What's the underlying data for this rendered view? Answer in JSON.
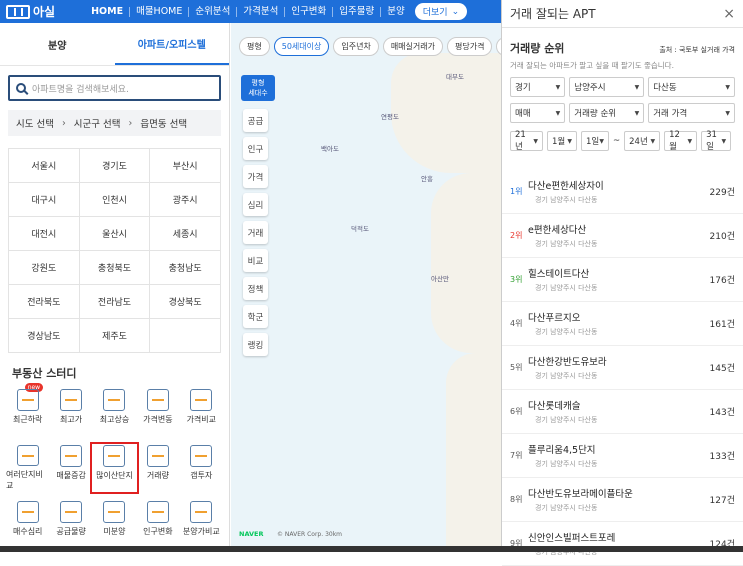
{
  "topbar": {
    "logo": "아실",
    "nav": [
      "HOME",
      "매물HOME",
      "순위분석",
      "가격분석",
      "인구변화",
      "입주물량",
      "분양"
    ],
    "more": "더보기"
  },
  "tabs": [
    "분양",
    "아파트/오피스텔"
  ],
  "search": {
    "placeholder": "아파트명을 검색해보세요."
  },
  "region": [
    "시도 선택",
    "시군구 선택",
    "읍면동 선택"
  ],
  "regions": [
    "서울시",
    "경기도",
    "부산시",
    "대구시",
    "인천시",
    "광주시",
    "대전시",
    "울산시",
    "세종시",
    "강원도",
    "충청북도",
    "충청남도",
    "전라북도",
    "전라남도",
    "경상북도",
    "경상남도",
    "제주도"
  ],
  "study": {
    "title": "부동산 스터디",
    "items": [
      "최근하락",
      "최고가",
      "최고상승",
      "가격변동",
      "가격비교",
      "여러단지비교",
      "매물증감",
      "많이산단지",
      "거래량",
      "갭투자",
      "매수심리",
      "공급물량",
      "미분양",
      "인구변화",
      "분양가비교"
    ],
    "new_badge": "new"
  },
  "map": {
    "chips": [
      "평형",
      "50세대이상",
      "입주년차",
      "매매실거래가",
      "평당가격",
      "매"
    ],
    "badge": [
      "평형",
      "세대수"
    ],
    "side": [
      "공급",
      "인구",
      "가격",
      "심리",
      "거래",
      "비교",
      "정책",
      "학군",
      "랭킹"
    ],
    "labels": [
      "백아도",
      "연평도",
      "덕적도",
      "아산만",
      "안흥",
      "대부도"
    ],
    "naver": "NAVER",
    "copyright": "© NAVER Corp.",
    "scale": "30km"
  },
  "panel": {
    "title": "거래 잘되는 APT",
    "close": "×",
    "subtitle": "거래량 순위",
    "source": "출처 : 국토부 실거래 가격",
    "desc": "거래 잘되는 아파트가 팔고 싶을 때 팔기도 좋습니다.",
    "selects1": [
      "경기",
      "남양주시",
      "다산동"
    ],
    "selects2": [
      "매매",
      "거래량 순위",
      "거래 가격"
    ],
    "dates": [
      "21년",
      "1월",
      "1일",
      "~",
      "24년",
      "12월",
      "31일"
    ],
    "ranks": [
      {
        "rank": "1위",
        "name": "다산e편한세상자이",
        "addr": "경기 남양주시 다산동",
        "count": "229건",
        "color": "#1e6fd9"
      },
      {
        "rank": "2위",
        "name": "e편한세상다산",
        "addr": "경기 남양주시 다산동",
        "count": "210건",
        "color": "#e8342b"
      },
      {
        "rank": "3위",
        "name": "힐스테이트다산",
        "addr": "경기 남양주시 다산동",
        "count": "176건",
        "color": "#2e9e2e"
      },
      {
        "rank": "4위",
        "name": "다산푸르지오",
        "addr": "경기 남양주시 다산동",
        "count": "161건",
        "color": "#555"
      },
      {
        "rank": "5위",
        "name": "다산한강반도유보라",
        "addr": "경기 남양주시 다산동",
        "count": "145건",
        "color": "#555"
      },
      {
        "rank": "6위",
        "name": "다산롯데캐슬",
        "addr": "경기 남양주시 다산동",
        "count": "143건",
        "color": "#555"
      },
      {
        "rank": "7위",
        "name": "플루리움4,5단지",
        "addr": "경기 남양주시 다산동",
        "count": "133건",
        "color": "#555"
      },
      {
        "rank": "8위",
        "name": "다산반도유보라메이플타운",
        "addr": "경기 남양주시 다산동",
        "count": "127건",
        "color": "#555"
      },
      {
        "rank": "9위",
        "name": "신안인스빌퍼스트포레",
        "addr": "경기 남양주시 다산동",
        "count": "124건",
        "color": "#555"
      }
    ]
  }
}
